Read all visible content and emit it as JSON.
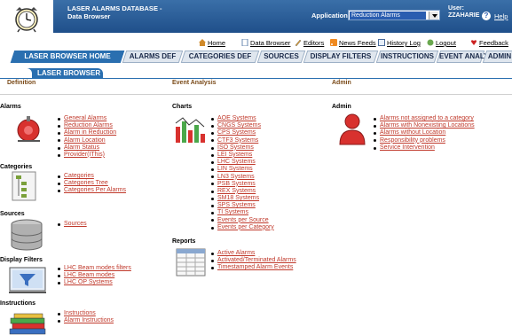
{
  "header": {
    "title_line1": "LASER ALARMS DATABASE -",
    "title_line2": "Data Browser",
    "application_label": "Application :",
    "application_value": "Reduction Alarms",
    "user_label": "User:",
    "user_name": "ZZAHARIE",
    "help_label": "Help"
  },
  "toolbar": {
    "home": "Home",
    "data_browser": "Data Browser",
    "editors": "Editors",
    "news_feeds": "News Feeds",
    "history_log": "History Log",
    "logout": "Logout",
    "feedback": "Feedback"
  },
  "tabs": [
    {
      "label": "LASER BROWSER HOME"
    },
    {
      "label": "ALARMS DEF"
    },
    {
      "label": "CATEGORIES DEF"
    },
    {
      "label": "SOURCES"
    },
    {
      "label": "DISPLAY FILTERS"
    },
    {
      "label": "INSTRUCTIONS"
    },
    {
      "label": "EVENT ANALYSIS"
    },
    {
      "label": "ADMIN"
    }
  ],
  "breadcrumb": "LASER BROWSER",
  "sections": {
    "definition": "Definition",
    "event_analysis": "Event Analysis",
    "admin": "Admin"
  },
  "alarms": {
    "title": "Alarms",
    "items": [
      "General Alarms",
      "Reduction Alarms",
      "Alarm in Reduction",
      "Alarm Location",
      "Alarm Status",
      "Provider(IThis)"
    ]
  },
  "categories": {
    "title": "Categories",
    "items": [
      "Categories",
      "Categories Tree",
      "Categories Per Alarms"
    ]
  },
  "sources": {
    "title": "Sources",
    "items": [
      "Sources"
    ]
  },
  "display_filters": {
    "title": "Display Filters",
    "items": [
      "LHC Beam modes filters",
      "LHC Beam modes",
      "LHC OP Systems"
    ]
  },
  "instructions": {
    "title": "Instructions",
    "items": [
      "Instructions",
      "Alarm Instructions"
    ]
  },
  "charts": {
    "title": "Charts",
    "items": [
      "AOE Systems",
      "CNGS Systems",
      "CPS Systems",
      "CTF3 Systems",
      "ISO Systems",
      "LEI Systems",
      "LHC Systems",
      "LIN Systems",
      "LN3 Systems",
      "PSB Systems",
      "REX Systems",
      "SM18 Systems",
      "SPS Systems",
      "TI Systems",
      "Events per Source",
      "Events per Category"
    ]
  },
  "reports": {
    "title": "Reports",
    "items": [
      "Active Alarms",
      "Activated/Terminated Alarms",
      "Timestamped Alarm Events"
    ]
  },
  "admin": {
    "title": "Admin",
    "items": [
      "Alarms not assigned to a category",
      "Alarms with Nonexisting Locations",
      "Alarms without Location",
      "Responsibility problems",
      "Service Intervention"
    ]
  },
  "colors": {
    "header_blue": "#1f4f8a",
    "tab_active": "#2a6fb0",
    "link_red": "#c0392b",
    "section_brown": "#7a4a18"
  }
}
